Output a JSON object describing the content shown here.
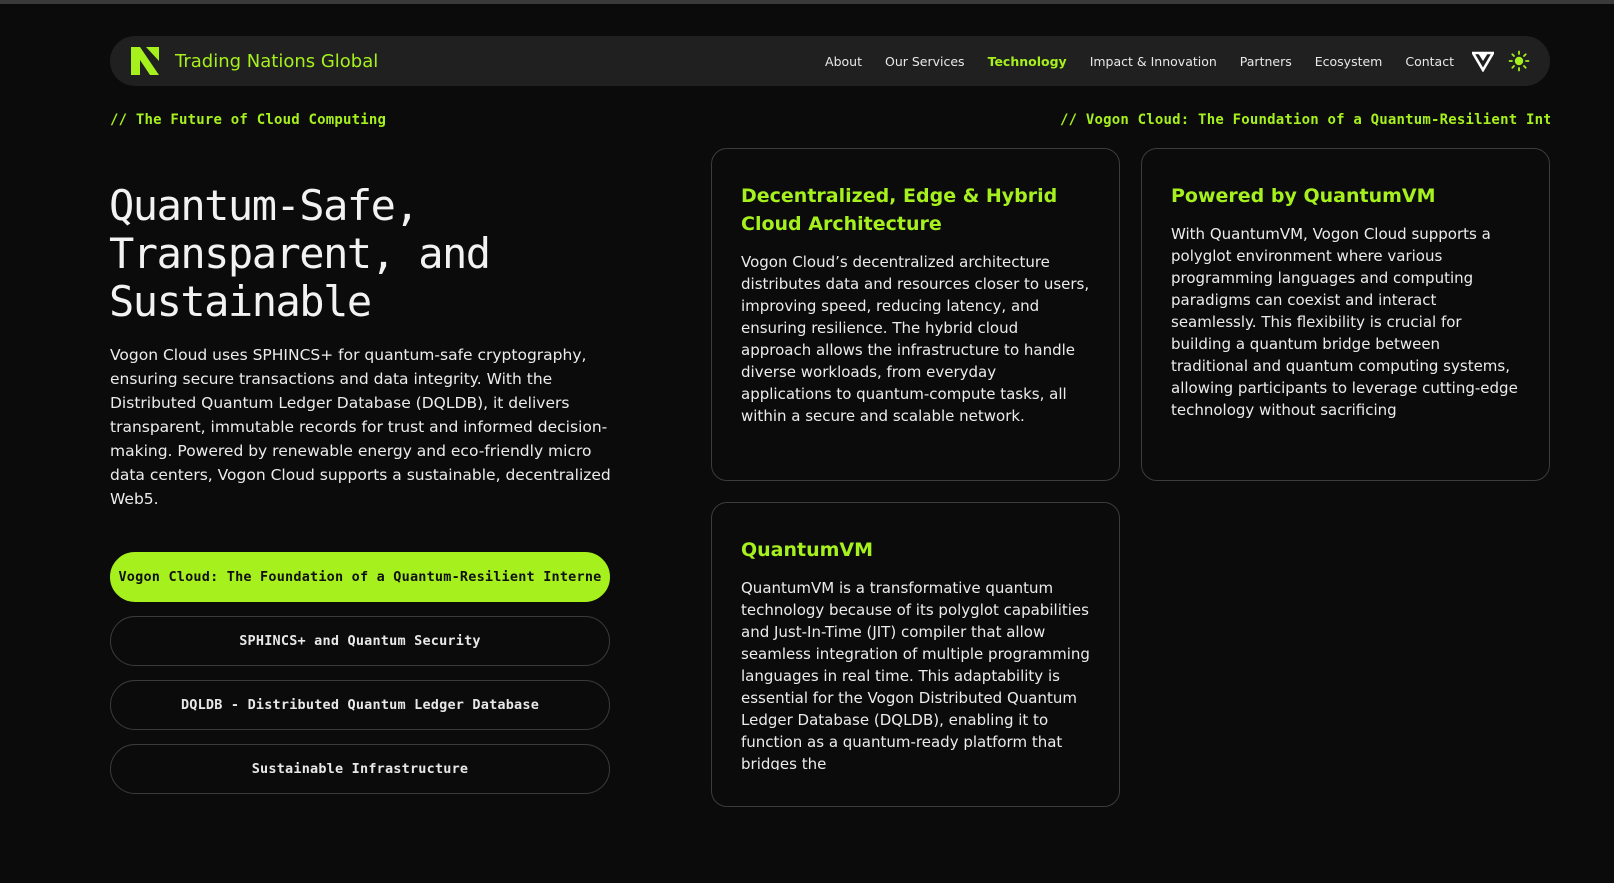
{
  "brand": {
    "name": "Trading Nations Global",
    "accent_color": "#a6f11d",
    "logo_icon": "n-logo-icon"
  },
  "nav": {
    "links": [
      {
        "label": "About",
        "active": false
      },
      {
        "label": "Our Services",
        "active": false
      },
      {
        "label": "Technology",
        "active": true
      },
      {
        "label": "Impact & Innovation",
        "active": false
      },
      {
        "label": "Partners",
        "active": false
      },
      {
        "label": "Ecosystem",
        "active": false
      },
      {
        "label": "Contact",
        "active": false
      }
    ],
    "icons": [
      "triangle-logo-icon",
      "sun-icon"
    ]
  },
  "eyebrows": {
    "left": "//  The Future of Cloud Computing",
    "right": "//  Vogon Cloud: The Foundation of a Quantum-Resilient Interne"
  },
  "hero": {
    "title": "Quantum-Safe, Transparent, and Sustainable",
    "description": "Vogon Cloud uses SPHINCS+ for quantum-safe cryptography, ensuring secure transactions and data integrity. With the Distributed Quantum Ledger Database (DQLDB), it delivers transparent, immutable records for trust and informed decision-making. Powered by renewable energy and eco-friendly micro data centers, Vogon Cloud supports a sustainable, decentralized Web5."
  },
  "topics": [
    {
      "label": "Vogon Cloud: The Foundation of a Quantum-Resilient Interne",
      "active": true
    },
    {
      "label": "SPHINCS+ and Quantum Security",
      "active": false
    },
    {
      "label": "DQLDB - Distributed Quantum Ledger Database",
      "active": false
    },
    {
      "label": "Sustainable Infrastructure",
      "active": false
    }
  ],
  "cards": [
    {
      "title": "Decentralized, Edge & Hybrid Cloud Architecture",
      "body": "Vogon Cloud’s decentralized architecture distributes data and resources closer to users, improving speed, reducing latency, and ensuring resilience. The hybrid cloud approach allows the infrastructure to handle diverse workloads, from everyday applications to quantum-compute tasks, all within a secure and scalable network."
    },
    {
      "title": "Powered by QuantumVM",
      "body": "With QuantumVM, Vogon Cloud supports a polyglot environment where various programming languages and computing paradigms can coexist and interact seamlessly. This flexibility is crucial for building a quantum bridge between traditional and quantum computing systems, allowing participants to leverage cutting-edge technology without sacrificing"
    },
    {
      "title": "QuantumVM",
      "body": "QuantumVM is a transformative quantum technology because of its polyglot capabilities and Just-In-Time (JIT) compiler that allow seamless integration of multiple programming languages in real time. This adaptability is essential for the Vogon Distributed Quantum Ledger Database (DQLDB), enabling it to function as a quantum-ready platform that bridges the"
    }
  ]
}
